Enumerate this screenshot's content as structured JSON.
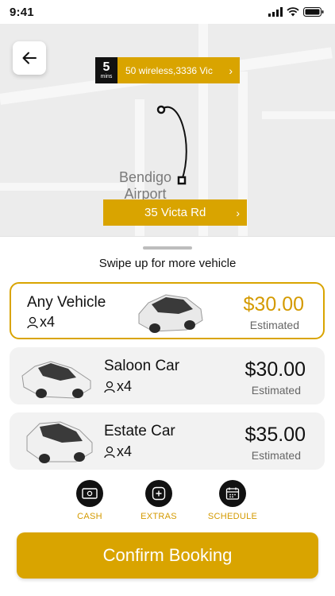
{
  "status_bar": {
    "time": "9:41"
  },
  "map": {
    "pickup": {
      "eta_value": "5",
      "eta_unit": "mins",
      "address": "50 wireless,3336 Vic"
    },
    "landmark_lines": [
      "Bendigo",
      "Airport"
    ],
    "dropoff": {
      "address": "35 Victa Rd"
    }
  },
  "sheet": {
    "hint": "Swipe up for more vehicle",
    "vehicles": [
      {
        "name": "Any Vehicle",
        "seats": "x4",
        "price": "$30.00",
        "note": "Estimated",
        "selected": true
      },
      {
        "name": "Saloon Car",
        "seats": "x4",
        "price": "$30.00",
        "note": "Estimated",
        "selected": false
      },
      {
        "name": "Estate Car",
        "seats": "x4",
        "price": "$35.00",
        "note": "Estimated",
        "selected": false
      }
    ],
    "options": [
      {
        "label": "CASH",
        "icon": "cash-icon"
      },
      {
        "label": "EXTRAS",
        "icon": "plus-icon"
      },
      {
        "label": "SCHEDULE",
        "icon": "calendar-icon"
      }
    ],
    "confirm_label": "Confirm Booking"
  },
  "colors": {
    "accent": "#d9a400",
    "price_accent": "#d49a00",
    "dark": "#111111",
    "card_bg": "#f2f2f2"
  }
}
